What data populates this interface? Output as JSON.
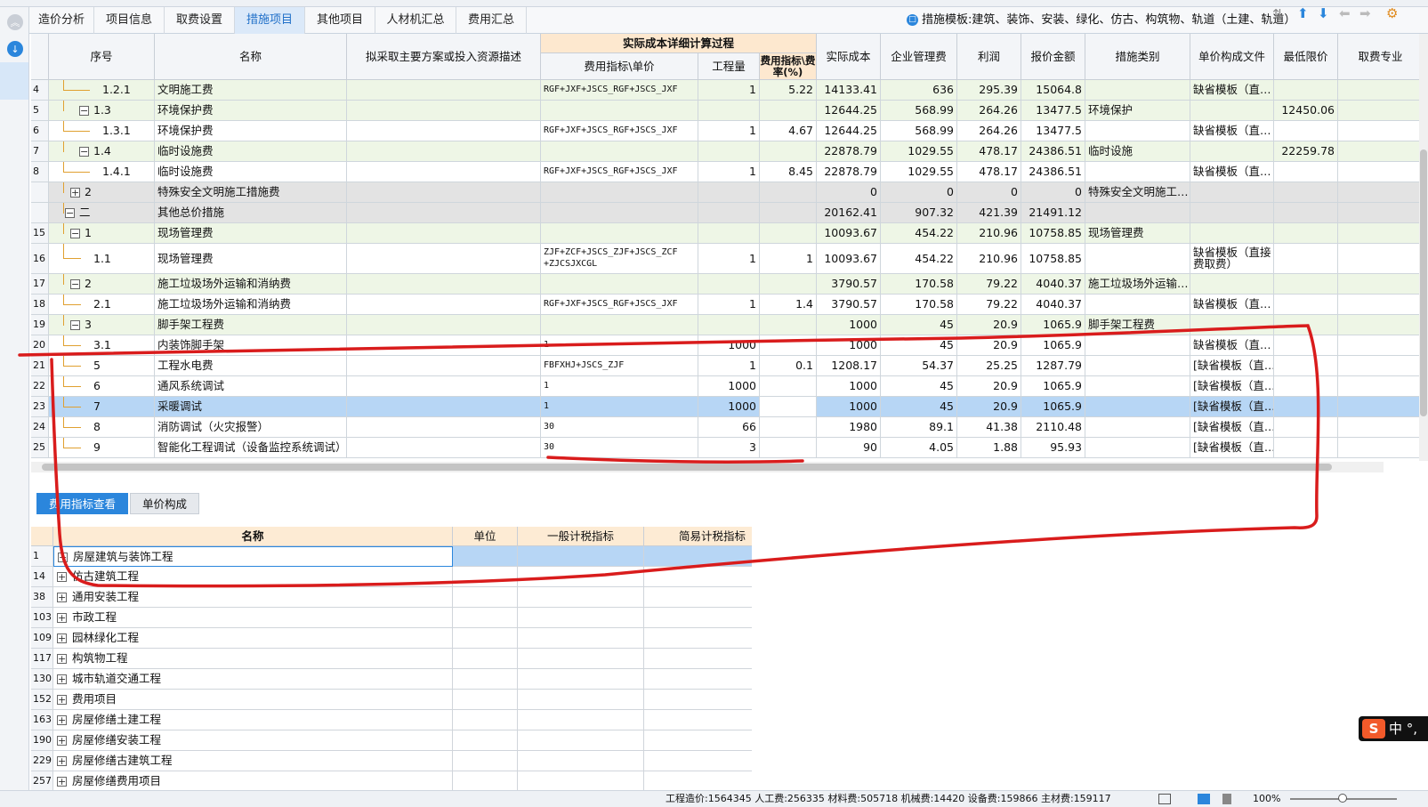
{
  "tabs": [
    "造价分析",
    "项目信息",
    "取费设置",
    "措施项目",
    "其他项目",
    "人材机汇总",
    "费用汇总"
  ],
  "active_tab": "措施项目",
  "template_label": "措施模板:建筑、装饰、安装、绿化、仿古、构筑物、轨道（土建、轨道）",
  "headers": {
    "seq": "序号",
    "name": "名称",
    "desc": "拟采取主要方案或投入资源描述",
    "group": "实际成本详细计算过程",
    "formula": "费用指标\\单价",
    "qty": "工程量",
    "rate": "费用指标\\费率(%)",
    "cost": "实际成本",
    "mgmt": "企业管理费",
    "profit": "利润",
    "quote": "报价金额",
    "cat": "措施类别",
    "file": "单价构成文件",
    "min": "最低限价",
    "fee": "取费专业"
  },
  "rows": [
    {
      "no": "4",
      "seq": "1.2.1",
      "name": "文明施工费",
      "formula": "RGF+JXF+JSCS_RGF+JSCS_JXF",
      "qty": "1",
      "rate": "5.22",
      "cost": "14133.41",
      "mgmt": "636",
      "profit": "295.39",
      "quote": "15064.8",
      "cat": "",
      "file": "缺省模板（直…",
      "min": ""
    },
    {
      "no": "5",
      "seq": "1.3",
      "name": "环境保护费",
      "formula": "",
      "qty": "",
      "rate": "",
      "cost": "12644.25",
      "mgmt": "568.99",
      "profit": "264.26",
      "quote": "13477.5",
      "cat": "环境保护",
      "file": "",
      "min": "12450.06"
    },
    {
      "no": "6",
      "seq": "1.3.1",
      "name": "环境保护费",
      "formula": "RGF+JXF+JSCS_RGF+JSCS_JXF",
      "qty": "1",
      "rate": "4.67",
      "cost": "12644.25",
      "mgmt": "568.99",
      "profit": "264.26",
      "quote": "13477.5",
      "cat": "",
      "file": "缺省模板（直…",
      "min": ""
    },
    {
      "no": "7",
      "seq": "1.4",
      "name": "临时设施费",
      "formula": "",
      "qty": "",
      "rate": "",
      "cost": "22878.79",
      "mgmt": "1029.55",
      "profit": "478.17",
      "quote": "24386.51",
      "cat": "临时设施",
      "file": "",
      "min": "22259.78"
    },
    {
      "no": "8",
      "seq": "1.4.1",
      "name": "临时设施费",
      "formula": "RGF+JXF+JSCS_RGF+JSCS_JXF",
      "qty": "1",
      "rate": "8.45",
      "cost": "22878.79",
      "mgmt": "1029.55",
      "profit": "478.17",
      "quote": "24386.51",
      "cat": "",
      "file": "缺省模板（直…",
      "min": ""
    },
    {
      "no": "",
      "seq": "2",
      "name": "特殊安全文明施工措施费",
      "formula": "",
      "qty": "",
      "rate": "",
      "cost": "0",
      "mgmt": "0",
      "profit": "0",
      "quote": "0",
      "cat": "特殊安全文明施工…",
      "file": "",
      "min": ""
    },
    {
      "no": "",
      "seq": "二",
      "name": "其他总价措施",
      "formula": "",
      "qty": "",
      "rate": "",
      "cost": "20162.41",
      "mgmt": "907.32",
      "profit": "421.39",
      "quote": "21491.12",
      "cat": "",
      "file": "",
      "min": ""
    },
    {
      "no": "15",
      "seq": "1",
      "name": "现场管理费",
      "formula": "",
      "qty": "",
      "rate": "",
      "cost": "10093.67",
      "mgmt": "454.22",
      "profit": "210.96",
      "quote": "10758.85",
      "cat": "现场管理费",
      "file": "",
      "min": ""
    },
    {
      "no": "16",
      "seq": "1.1",
      "name": "现场管理费",
      "formula": "ZJF+ZCF+JSCS_ZJF+JSCS_ZCF",
      "formula2": "+ZJCSJXCGL",
      "qty": "1",
      "rate": "1",
      "cost": "10093.67",
      "mgmt": "454.22",
      "profit": "210.96",
      "quote": "10758.85",
      "cat": "",
      "file": "缺省模板（直接",
      "file2": "费取费）",
      "min": ""
    },
    {
      "no": "17",
      "seq": "2",
      "name": "施工垃圾场外运输和消纳费",
      "formula": "",
      "qty": "",
      "rate": "",
      "cost": "3790.57",
      "mgmt": "170.58",
      "profit": "79.22",
      "quote": "4040.37",
      "cat": "施工垃圾场外运输…",
      "file": "",
      "min": ""
    },
    {
      "no": "18",
      "seq": "2.1",
      "name": "施工垃圾场外运输和消纳费",
      "formula": "RGF+JXF+JSCS_RGF+JSCS_JXF",
      "qty": "1",
      "rate": "1.4",
      "cost": "3790.57",
      "mgmt": "170.58",
      "profit": "79.22",
      "quote": "4040.37",
      "cat": "",
      "file": "缺省模板（直…",
      "min": ""
    },
    {
      "no": "19",
      "seq": "3",
      "name": "脚手架工程费",
      "formula": "",
      "qty": "",
      "rate": "",
      "cost": "1000",
      "mgmt": "45",
      "profit": "20.9",
      "quote": "1065.9",
      "cat": "脚手架工程费",
      "file": "",
      "min": ""
    },
    {
      "no": "20",
      "seq": "3.1",
      "name": "内装饰脚手架",
      "formula": "1",
      "qty": "1000",
      "rate": "",
      "cost": "1000",
      "mgmt": "45",
      "profit": "20.9",
      "quote": "1065.9",
      "cat": "",
      "file": "缺省模板（直…",
      "min": ""
    },
    {
      "no": "21",
      "seq": "5",
      "name": "工程水电费",
      "formula": "FBFXHJ+JSCS_ZJF",
      "qty": "1",
      "rate": "0.1",
      "cost": "1208.17",
      "mgmt": "54.37",
      "profit": "25.25",
      "quote": "1287.79",
      "cat": "",
      "file": "[缺省模板（直…",
      "min": ""
    },
    {
      "no": "22",
      "seq": "6",
      "name": "通风系统调试",
      "formula": "1",
      "qty": "1000",
      "rate": "",
      "cost": "1000",
      "mgmt": "45",
      "profit": "20.9",
      "quote": "1065.9",
      "cat": "",
      "file": "[缺省模板（直…",
      "min": ""
    },
    {
      "no": "23",
      "seq": "7",
      "name": "采暖调试",
      "formula": "1",
      "qty": "1000",
      "rate": "",
      "cost": "1000",
      "mgmt": "45",
      "profit": "20.9",
      "quote": "1065.9",
      "cat": "",
      "file": "[缺省模板（直…",
      "min": ""
    },
    {
      "no": "24",
      "seq": "8",
      "name": "消防调试（火灾报警）",
      "formula": "30",
      "qty": "66",
      "rate": "",
      "cost": "1980",
      "mgmt": "89.1",
      "profit": "41.38",
      "quote": "2110.48",
      "cat": "",
      "file": "[缺省模板（直…",
      "min": ""
    },
    {
      "no": "25",
      "seq": "9",
      "name": "智能化工程调试（设备监控系统调试）",
      "formula": "30",
      "qty": "3",
      "rate": "",
      "cost": "90",
      "mgmt": "4.05",
      "profit": "1.88",
      "quote": "95.93",
      "cat": "",
      "file": "[缺省模板（直…",
      "min": ""
    }
  ],
  "bottom_tabs": [
    "费用指标查看",
    "单价构成"
  ],
  "lower_headers": [
    "名称",
    "单位",
    "一般计税指标",
    "简易计税指标"
  ],
  "lower_rows": [
    {
      "no": "1",
      "name": "房屋建筑与装饰工程"
    },
    {
      "no": "14",
      "name": "仿古建筑工程"
    },
    {
      "no": "38",
      "name": "通用安装工程"
    },
    {
      "no": "103",
      "name": "市政工程"
    },
    {
      "no": "109",
      "name": "园林绿化工程"
    },
    {
      "no": "117",
      "name": "构筑物工程"
    },
    {
      "no": "130",
      "name": "城市轨道交通工程"
    },
    {
      "no": "152",
      "name": "费用项目"
    },
    {
      "no": "163",
      "name": "房屋修缮土建工程"
    },
    {
      "no": "190",
      "name": "房屋修缮安装工程"
    },
    {
      "no": "229",
      "name": "房屋修缮古建筑工程"
    },
    {
      "no": "257",
      "name": "房屋修缮费用项目"
    }
  ],
  "status_text": "工程造价:1564345  人工费:256335  材料费:505718  机械费:14420  设备费:159866  主材费:159117",
  "zoom": "100%",
  "ime_label": "中"
}
